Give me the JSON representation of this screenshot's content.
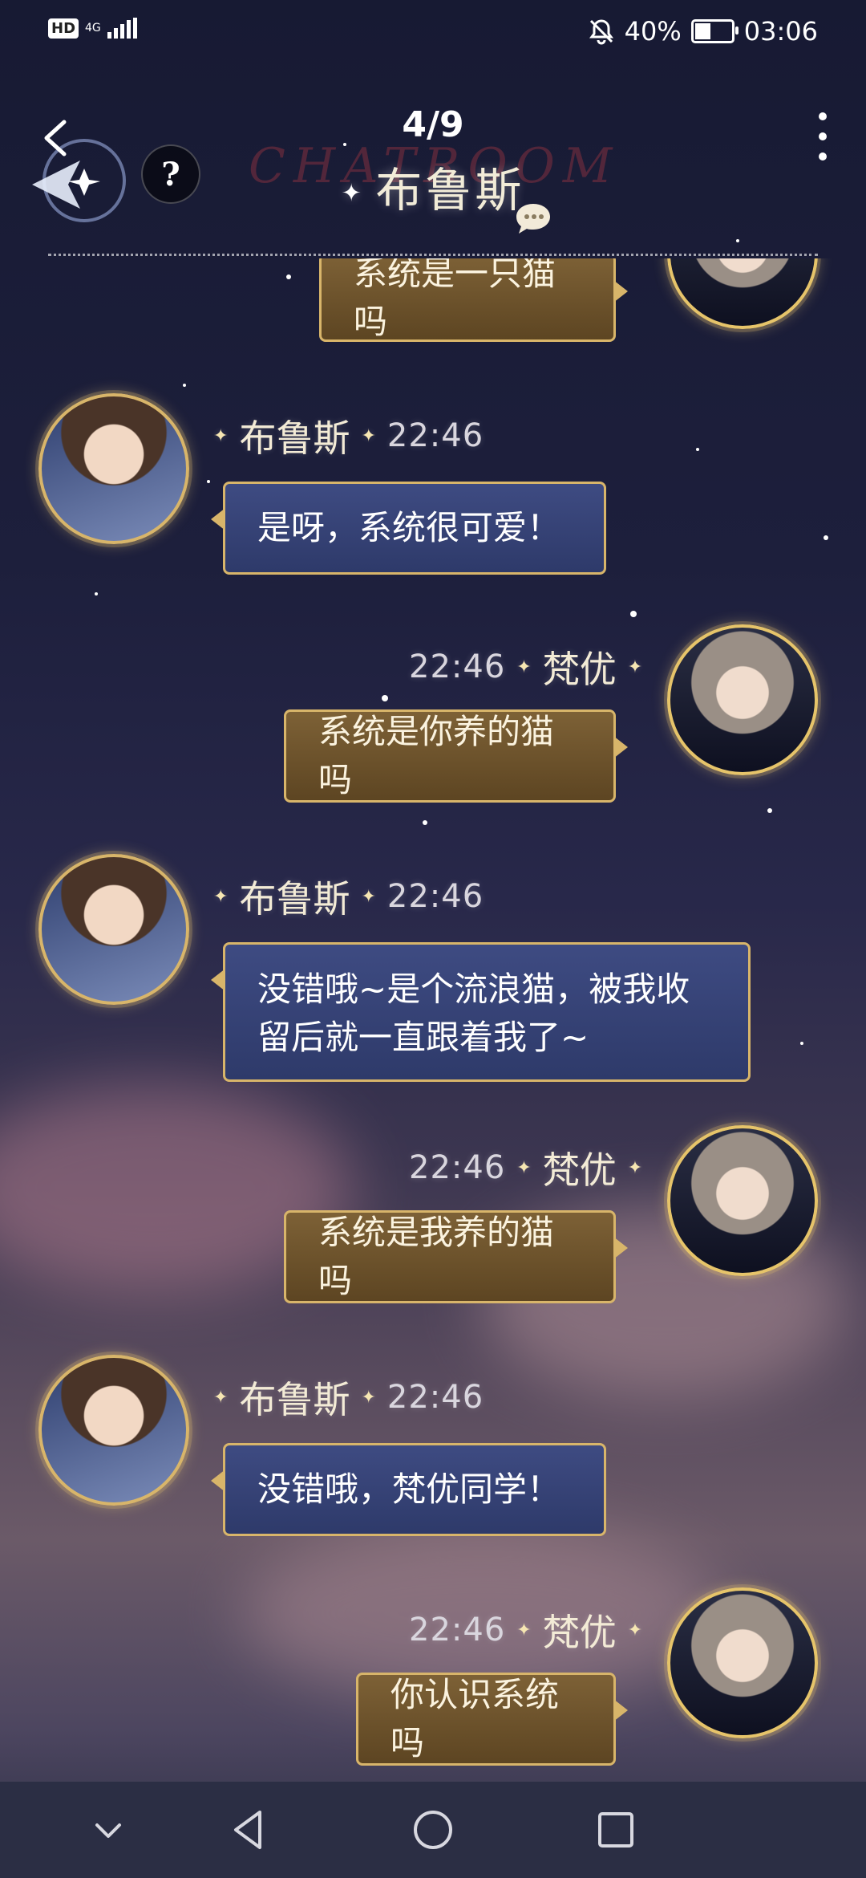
{
  "status_bar": {
    "hd": "HD",
    "network": "4G",
    "battery_percent": "40%",
    "battery_level": 0.4,
    "time": "03:06",
    "icons": [
      "hd-icon",
      "signal-icon",
      "mute-icon",
      "battery-icon"
    ]
  },
  "header": {
    "counter": "4/9",
    "title": "布鲁斯",
    "watermark": "CHATROOM",
    "help": "?"
  },
  "messages": [
    {
      "side": "right",
      "text": "系统是一只猫吗"
    },
    {
      "side": "left",
      "name": "布鲁斯",
      "time": "22:46",
      "text": "是呀，系统很可爱！"
    },
    {
      "side": "right",
      "name": "梵优",
      "time": "22:46",
      "text": "系统是你养的猫吗"
    },
    {
      "side": "left",
      "name": "布鲁斯",
      "time": "22:46",
      "text_line1": "没错哦~是个流浪猫，被我收",
      "text_line2": "留后就一直跟着我了~"
    },
    {
      "side": "right",
      "name": "梵优",
      "time": "22:46",
      "text": "系统是我养的猫吗"
    },
    {
      "side": "left",
      "name": "布鲁斯",
      "time": "22:46",
      "text": "没错哦，梵优同学！"
    },
    {
      "side": "right",
      "name": "梵优",
      "time": "22:46",
      "text": "你认识系统吗"
    }
  ],
  "colors": {
    "accent_gold": "#d8b56a",
    "bubble_blue": "#3e4b82",
    "bubble_gold": "#7d6136"
  }
}
